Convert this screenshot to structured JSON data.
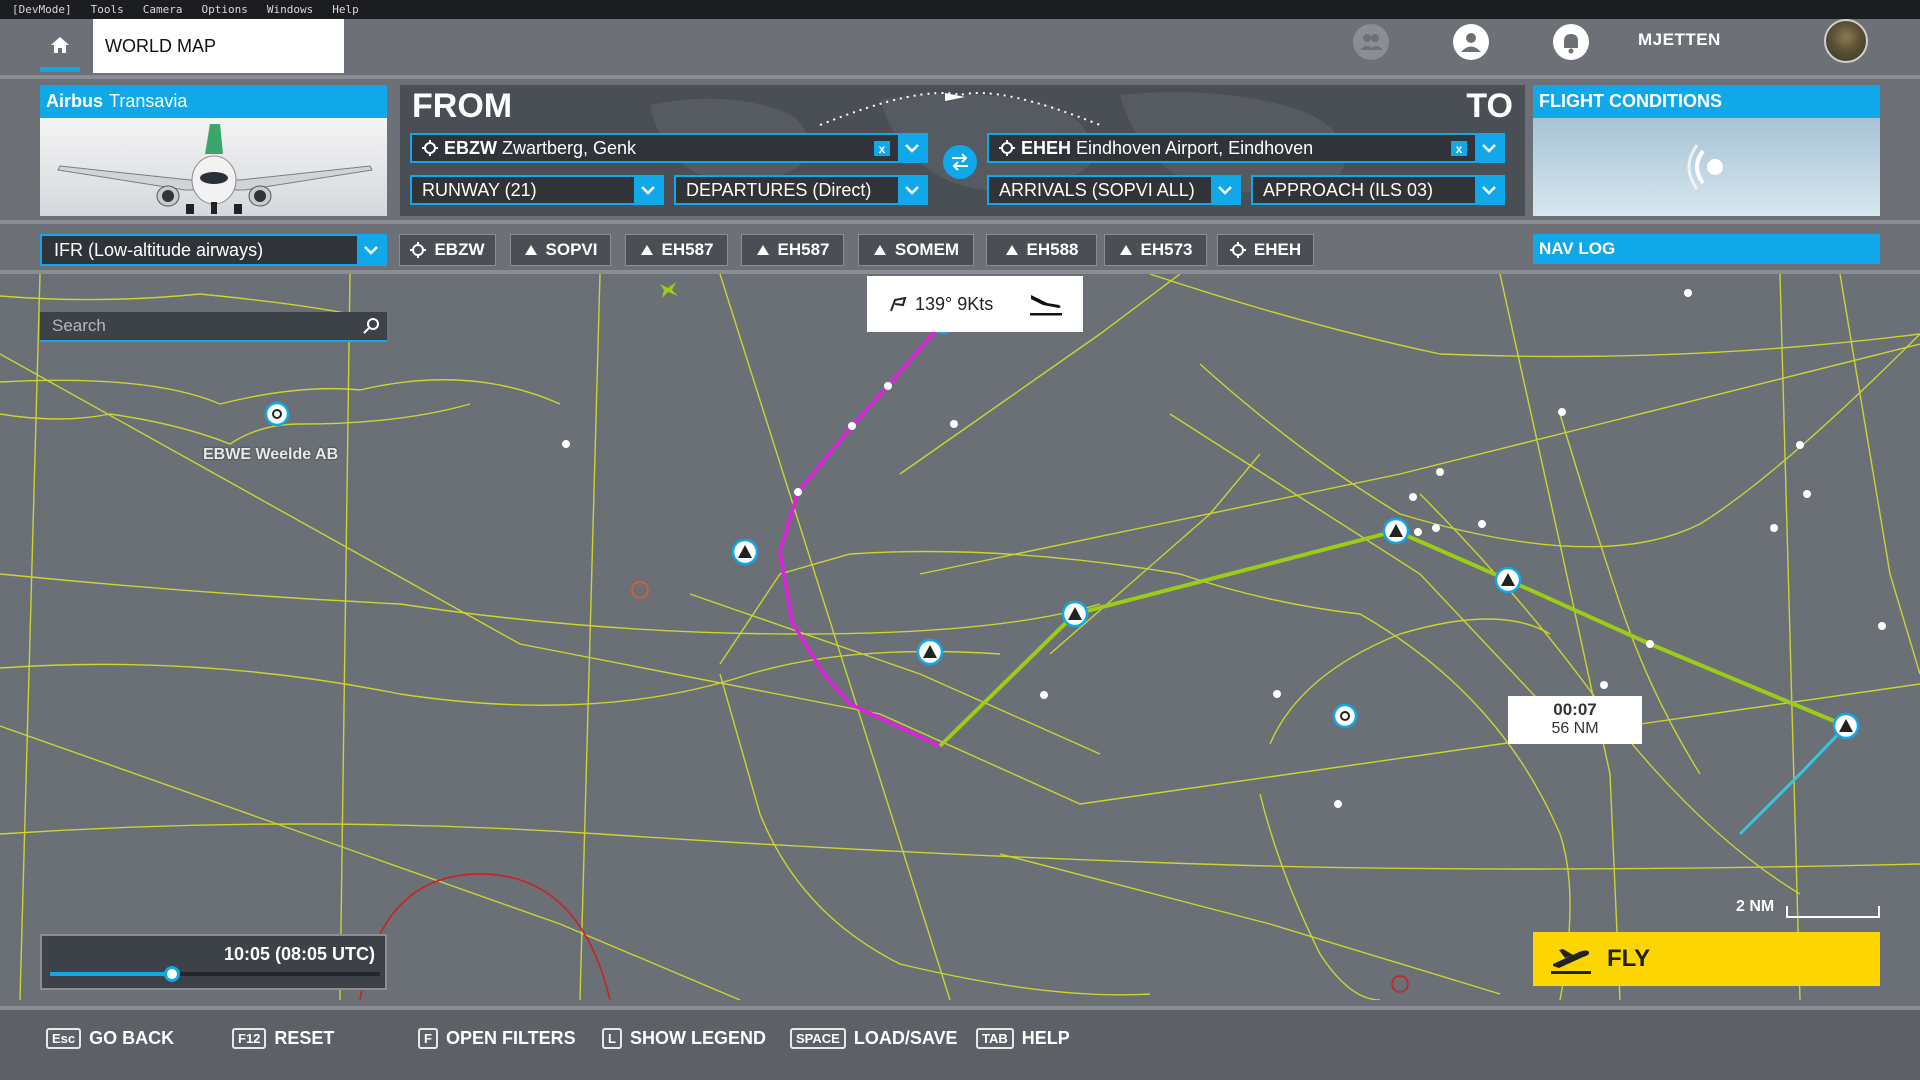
{
  "devmenu": {
    "items": [
      "[DevMode]",
      "Tools",
      "Camera",
      "Options",
      "Windows",
      "Help"
    ]
  },
  "header": {
    "home_icon": "home-icon",
    "tab_label": "WORLD MAP",
    "username": "MJETTEN",
    "icons": [
      "friends-icon",
      "profile-icon",
      "notifications-icon"
    ]
  },
  "aircraft": {
    "brand": "Airbus",
    "livery": "Transavia"
  },
  "route": {
    "from_label": "FROM",
    "to_label": "TO",
    "departure": {
      "icao": "EBZW",
      "name": "Zwartberg, Genk"
    },
    "arrival": {
      "icao": "EHEH",
      "name": "Eindhoven Airport, Eindhoven"
    },
    "runway": "RUNWAY (21)",
    "departures": "DEPARTURES (Direct)",
    "arrivals": "ARRIVALS (SOPVI ALL)",
    "approach": "APPROACH (ILS 03)",
    "clear_label": "x"
  },
  "conditions": {
    "title": "FLIGHT CONDITIONS"
  },
  "flightplan": {
    "type": "IFR (Low-altitude airways)",
    "waypoints": [
      {
        "label": "EBZW",
        "kind": "airport"
      },
      {
        "label": "SOPVI",
        "kind": "fix"
      },
      {
        "label": "EH587",
        "kind": "fix"
      },
      {
        "label": "EH587",
        "kind": "fix"
      },
      {
        "label": "SOMEM",
        "kind": "fix"
      },
      {
        "label": "EH588",
        "kind": "fix"
      },
      {
        "label": "EH573",
        "kind": "fix"
      },
      {
        "label": "EHEH",
        "kind": "airport"
      }
    ],
    "navlog_label": "NAV LOG"
  },
  "map": {
    "search_placeholder": "Search",
    "wind": "139° 9Kts",
    "leg_time": "00:07",
    "leg_distance": "56 NM",
    "airport_label": "EBWE Weelde AB",
    "time": "10:05 (08:05 UTC)",
    "time_progress": 0.37,
    "scale": "2 NM"
  },
  "actions": {
    "fly": "FLY"
  },
  "footer": [
    {
      "key": "Esc",
      "label": "GO BACK"
    },
    {
      "key": "F12",
      "label": "RESET"
    },
    {
      "key": "F",
      "label": "OPEN FILTERS"
    },
    {
      "key": "L",
      "label": "SHOW LEGEND"
    },
    {
      "key": "SPACE",
      "label": "LOAD/SAVE"
    },
    {
      "key": "TAB",
      "label": "HELP"
    }
  ],
  "colors": {
    "accent": "#10a8e8",
    "fly": "#fdd500",
    "route_departure": "#e020e0",
    "route_airway": "#9ccc18",
    "airways": "#d8e030"
  }
}
